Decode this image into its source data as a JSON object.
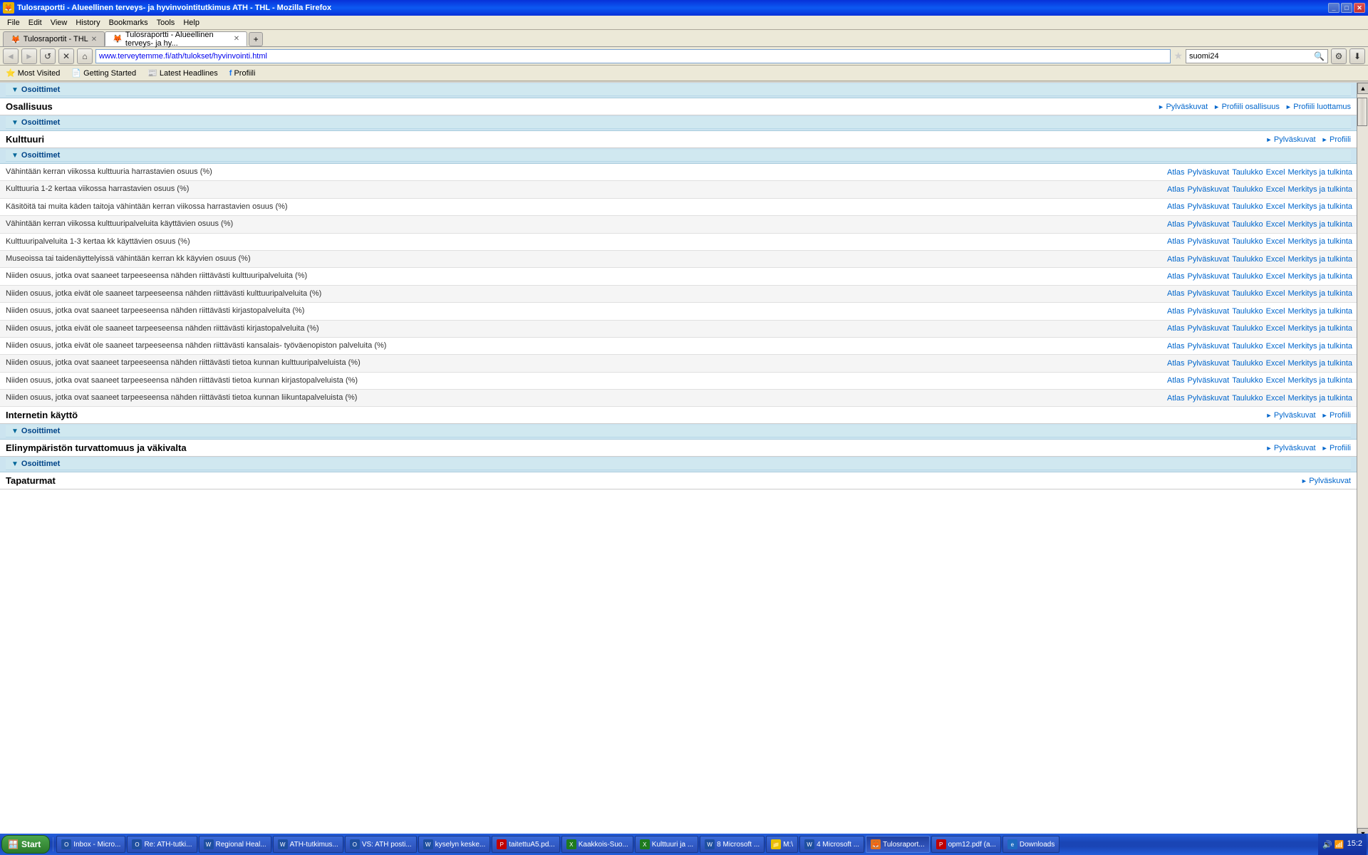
{
  "window": {
    "title": "Tulosraportti - Alueellinen terveys- ja hyvinvointitutkimus ATH - THL - Mozilla Firefox",
    "icon": "🦊"
  },
  "menu": {
    "items": [
      "File",
      "Edit",
      "View",
      "History",
      "Bookmarks",
      "Tools",
      "Help"
    ]
  },
  "tabs": [
    {
      "label": "Tulosraportit - THL",
      "active": false
    },
    {
      "label": "Tulosraportti - Alueellinen terveys- ja hy...",
      "active": true
    }
  ],
  "address_bar": {
    "url": "www.terveytemme.fi/ath/tulokset/hyvinvointi.html",
    "search_placeholder": "suomi24"
  },
  "bookmarks": [
    {
      "label": "Most Visited"
    },
    {
      "label": "Getting Started"
    },
    {
      "label": "Latest Headlines"
    },
    {
      "label": "Profiili"
    }
  ],
  "sections": [
    {
      "id": "osallisuus",
      "title": "Osallisuus",
      "links": [
        "Pylväskuvat",
        "Profiili osallisuus",
        "Profiili luottamus"
      ],
      "has_osoittimet": true
    },
    {
      "id": "kulttuuri",
      "title": "Kulttuuri",
      "links": [
        "Pylväskuvat",
        "Profiili"
      ],
      "has_osoittimet": true,
      "rows": [
        {
          "label": "Vähintään kerran viikossa kulttuuria harrastavien osuus (%)",
          "links": [
            "Atlas",
            "Pylväskuvat",
            "Taulukko",
            "Excel",
            "Merkitys ja tulkinta"
          ]
        },
        {
          "label": "Kulttuuria 1-2 kertaa viikossa harrastavien osuus (%)",
          "links": [
            "Atlas",
            "Pylväskuvat",
            "Taulukko",
            "Excel",
            "Merkitys ja tulkinta"
          ]
        },
        {
          "label": "Käsitöitä tai muita käden taitoja vähintään kerran viikossa harrastavien osuus (%)",
          "links": [
            "Atlas",
            "Pylväskuvat",
            "Taulukko",
            "Excel",
            "Merkitys ja tulkinta"
          ]
        },
        {
          "label": "Vähintään kerran viikossa kulttuuripalveluita käyttävien osuus (%)",
          "links": [
            "Atlas",
            "Pylväskuvat",
            "Taulukko",
            "Excel",
            "Merkitys ja tulkinta"
          ]
        },
        {
          "label": "Kulttuuripalveluita 1-3 kertaa kk käyttävien osuus (%)",
          "links": [
            "Atlas",
            "Pylväskuvat",
            "Taulukko",
            "Excel",
            "Merkitys ja tulkinta"
          ]
        },
        {
          "label": "Museoissa tai taidenäyttelyissä vähintään kerran kk käyvien osuus (%)",
          "links": [
            "Atlas",
            "Pylväskuvat",
            "Taulukko",
            "Excel",
            "Merkitys ja tulkinta"
          ]
        },
        {
          "label": "Niiden osuus, jotka ovat saaneet tarpeeseensa nähden riittävästi kulttuuripalveluita (%)",
          "links": [
            "Atlas",
            "Pylväskuvat",
            "Taulukko",
            "Excel",
            "Merkitys ja tulkinta"
          ]
        },
        {
          "label": "Niiden osuus, jotka eivät ole saaneet tarpeeseensa nähden riittävästi kulttuuripalveluita (%)",
          "links": [
            "Atlas",
            "Pylväskuvat",
            "Taulukko",
            "Excel",
            "Merkitys ja tulkinta"
          ]
        },
        {
          "label": "Niiden osuus, jotka ovat saaneet tarpeeseensa nähden riittävästi kirjastopalveluita (%)",
          "links": [
            "Atlas",
            "Pylväskuvat",
            "Taulukko",
            "Excel",
            "Merkitys ja tulkinta"
          ]
        },
        {
          "label": "Niiden osuus, jotka eivät ole saaneet tarpeeseensa nähden riittävästi kirjastopalveluita (%)",
          "links": [
            "Atlas",
            "Pylväskuvat",
            "Taulukko",
            "Excel",
            "Merkitys ja tulkinta"
          ]
        },
        {
          "label": "Niiden osuus, jotka eivät ole saaneet tarpeeseensa nähden riittävästi kansalais- työväenopiston palveluita (%)",
          "links": [
            "Atlas",
            "Pylväskuvat",
            "Taulukko",
            "Excel",
            "Merkitys ja tulkinta"
          ]
        },
        {
          "label": "Niiden osuus, jotka ovat saaneet tarpeeseensa nähden riittävästi tietoa kunnan kulttuuripalveluista (%)",
          "links": [
            "Atlas",
            "Pylväskuvat",
            "Taulukko",
            "Excel",
            "Merkitys ja tulkinta"
          ]
        },
        {
          "label": "Niiden osuus, jotka ovat saaneet tarpeeseensa nähden riittävästi tietoa kunnan kirjastopalveluista (%)",
          "links": [
            "Atlas",
            "Pylväskuvat",
            "Taulukko",
            "Excel",
            "Merkitys ja tulkinta"
          ]
        },
        {
          "label": "Niiden osuus, jotka ovat saaneet tarpeeseensa nähden riittävästi tietoa kunnan liikuntapalveluista (%)",
          "links": [
            "Atlas",
            "Pylväskuvat",
            "Taulukko",
            "Excel",
            "Merkitys ja tulkinta"
          ]
        }
      ]
    },
    {
      "id": "internetin-kaytto",
      "title": "Internetin käyttö",
      "links": [
        "Pylväskuvat",
        "Profiili"
      ],
      "has_osoittimet": true
    },
    {
      "id": "elinymparisto",
      "title": "Elinympäristön turvattomuus ja väkivalta",
      "links": [
        "Pylväskuvat",
        "Profiili"
      ],
      "has_osoittimet": true
    },
    {
      "id": "tapaturmat",
      "title": "Tapaturmat",
      "partial_link": "Pylväskuvat",
      "has_osoittimet": true
    }
  ],
  "top_osoittimet": {
    "label": "Osoittimet"
  },
  "status_bar": {
    "text": ""
  },
  "taskbar": {
    "start_label": "Start",
    "time": "15:2",
    "buttons": [
      {
        "label": "Inbox - Micro...",
        "type": "outlook"
      },
      {
        "label": "Re: ATH-tutki...",
        "type": "outlook"
      },
      {
        "label": "Regional Heal...",
        "type": "word"
      },
      {
        "label": "ATH-tutkimus...",
        "type": "word"
      },
      {
        "label": "VS: ATH posti...",
        "type": "outlook"
      },
      {
        "label": "kyselyn keske...",
        "type": "word"
      },
      {
        "label": "taitettuA5.pd...",
        "type": "pdf"
      },
      {
        "label": "Kaakkois-Suo...",
        "type": "excel"
      },
      {
        "label": "Kulttuuri ja ...",
        "type": "excel"
      },
      {
        "label": "8 Microsoft ...",
        "type": "word"
      },
      {
        "label": "M:\\",
        "type": "explorer"
      },
      {
        "label": "4 Microsoft ...",
        "type": "word"
      },
      {
        "label": "Tulosraport...",
        "type": "ff",
        "active": true
      },
      {
        "label": "opm12.pdf (a...",
        "type": "pdf"
      },
      {
        "label": "Downloads",
        "type": "ie"
      }
    ]
  }
}
